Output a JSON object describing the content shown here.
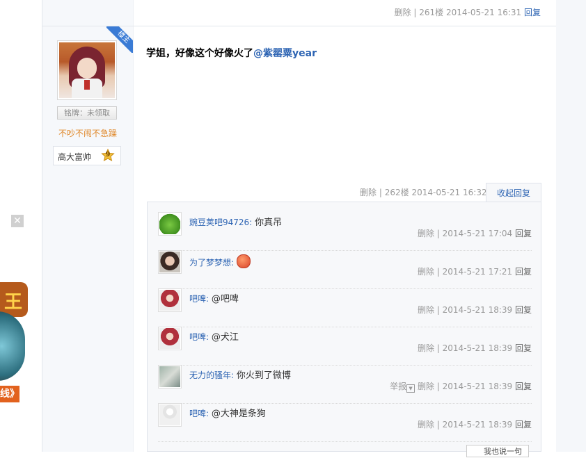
{
  "previous_post": {
    "delete_label": "删除",
    "separator": "|",
    "floor": "261楼",
    "time": "2014-05-21 16:31",
    "reply_label": "回复"
  },
  "author": {
    "owner_badge": "楼主",
    "badge_label": "铭牌：未领取",
    "tagline": "不吵不闹不急躁",
    "level_name": "高大富帅",
    "level_number": "9"
  },
  "post": {
    "text": "学姐，好像这个好像火了",
    "mention": "@紫罂粟year",
    "delete_label": "删除",
    "separator": "|",
    "floor": "262楼",
    "time": "2014-05-21 16:32",
    "collapse_label": "收起回复"
  },
  "replies": [
    {
      "user": "豌豆荚吧94726",
      "colon": ":",
      "content": "你真吊",
      "delete_label": "删除",
      "separator": "|",
      "time": "2014-5-21 17:04",
      "reply_label": "回复",
      "report_label": ""
    },
    {
      "user": "为了梦梦想",
      "colon": ":",
      "content": "",
      "emoji": "smiley-emoji",
      "delete_label": "删除",
      "separator": "|",
      "time": "2014-5-21 17:21",
      "reply_label": "回复",
      "report_label": ""
    },
    {
      "user": "吧啤",
      "colon": ":",
      "content": "@吧啤",
      "delete_label": "删除",
      "separator": "|",
      "time": "2014-5-21 18:39",
      "reply_label": "回复",
      "report_label": ""
    },
    {
      "user": "吧啤",
      "colon": ":",
      "content": "@犬江",
      "delete_label": "删除",
      "separator": "|",
      "time": "2014-5-21 18:39",
      "reply_label": "回复",
      "report_label": ""
    },
    {
      "user": "无力的骚年",
      "colon": ":",
      "content": "你火到了微博",
      "delete_label": "删除",
      "separator": "|",
      "time": "2014-5-21 18:39",
      "reply_label": "回复",
      "report_label": "举报"
    },
    {
      "user": "吧啤",
      "colon": ":",
      "content": "@大神是条狗",
      "delete_label": "删除",
      "separator": "|",
      "time": "2014-5-21 18:39",
      "reply_label": "回复",
      "report_label": ""
    }
  ],
  "reply_input_label": "我也说一句",
  "ad": {
    "sign_text": "王",
    "button_text": "线》"
  },
  "colors": {
    "link": "#2d64b3",
    "meta": "#999999",
    "tagline": "#e08a2e",
    "owner_ribbon": "#3a7bd5"
  }
}
